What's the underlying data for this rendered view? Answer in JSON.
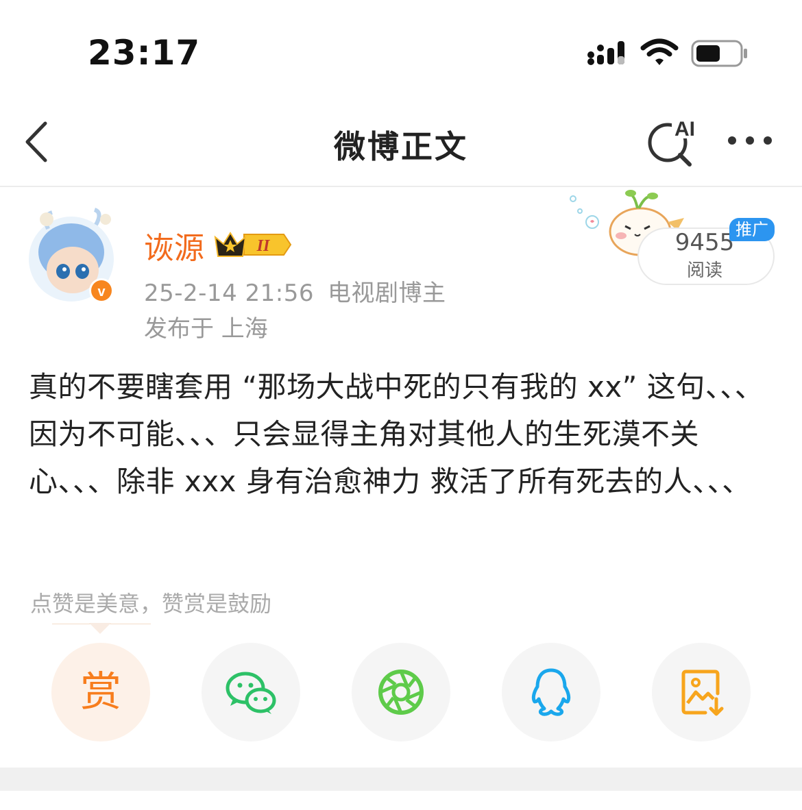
{
  "status_bar": {
    "time": "23:17"
  },
  "nav": {
    "title": "微博正文",
    "ai_label": "AI"
  },
  "post": {
    "author": {
      "name": "诙源",
      "vip_level": "II"
    },
    "date": "25-2-14 21:56",
    "author_tag": "电视剧博主",
    "location": "发布于 上海",
    "read_count": "9455",
    "read_label": "阅读",
    "promo_badge": "推广",
    "content": "真的不要瞎套用 “那场大战中死的只有我的 xx” 这句、、、因为不可能、、、只会显得主角对其他人的生死漠不关心、、、除非 xxx 身有治愈神力 救活了所有死去的人、、、"
  },
  "reward": {
    "hint": "点赞是美意，赞赏是鼓励",
    "reward_glyph": "赏"
  },
  "share_buttons": [
    {
      "icon": "reward-icon"
    },
    {
      "icon": "wechat-icon"
    },
    {
      "icon": "moments-icon"
    },
    {
      "icon": "qq-icon"
    },
    {
      "icon": "save-image-icon"
    }
  ],
  "colors": {
    "accent_orange": "#f26b1d",
    "promo_blue": "#2c95f0",
    "wechat_green": "#2dc167",
    "moments_green": "#5ecb4a",
    "qq_blue": "#1aa7ec",
    "save_orange": "#f7a51d"
  }
}
